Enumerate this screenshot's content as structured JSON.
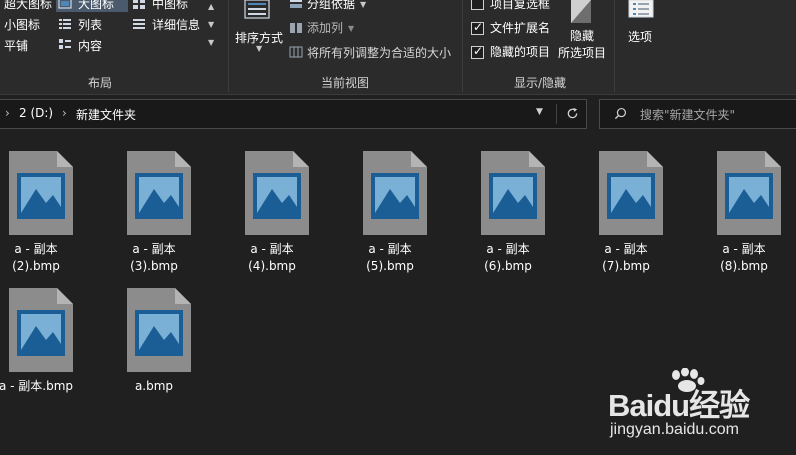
{
  "ribbon": {
    "layout": {
      "group_label": "布局",
      "items": {
        "extra_large": "超大图标",
        "large": "大图标",
        "medium": "中图标",
        "small": "小图标",
        "list": "列表",
        "details": "详细信息",
        "tiles": "平铺",
        "content": "内容"
      },
      "selected": "large"
    },
    "current_view": {
      "group_label": "当前视图",
      "sort_by": "排序方式",
      "group_by": "分组依据",
      "add_columns": "添加列",
      "size_all_columns": "将所有列调整为合适的大小"
    },
    "show_hide": {
      "group_label": "显示/隐藏",
      "item_checkboxes": {
        "label": "项目复选框",
        "checked": false
      },
      "file_name_extensions": {
        "label": "文件扩展名",
        "checked": true
      },
      "hidden_items": {
        "label": "隐藏的项目",
        "checked": true
      },
      "hide_selected_line1": "隐藏",
      "hide_selected_line2": "所选项目"
    },
    "options": {
      "label": "选项"
    }
  },
  "address": {
    "path": [
      "2 (D:)",
      "新建文件夹"
    ],
    "separator": "›",
    "dropdown_icon": "chevron-down-icon",
    "refresh_icon": "refresh-icon"
  },
  "search": {
    "placeholder": "搜索\"新建文件夹\""
  },
  "files": [
    {
      "line1": "a - 副本",
      "line2": "(2).bmp"
    },
    {
      "line1": "a - 副本",
      "line2": "(3).bmp"
    },
    {
      "line1": "a - 副本",
      "line2": "(4).bmp"
    },
    {
      "line1": "a - 副本",
      "line2": "(5).bmp"
    },
    {
      "line1": "a - 副本",
      "line2": "(6).bmp"
    },
    {
      "line1": "a - 副本",
      "line2": "(7).bmp"
    },
    {
      "line1": "a - 副本",
      "line2": "(8).bmp"
    },
    {
      "line1": "a - 副本.bmp",
      "line2": ""
    },
    {
      "line1": "a.bmp",
      "line2": ""
    }
  ],
  "watermark": {
    "brand": "Baidu经验",
    "url": "jingyan.baidu.com"
  },
  "colors": {
    "background": "#202020",
    "ribbon": "#2b2b2b",
    "file_page": "#8c8c8c",
    "image_frame": "#1b5e96",
    "image_sky": "#7ab0d6",
    "selected_highlight": "#4a5a6c"
  }
}
